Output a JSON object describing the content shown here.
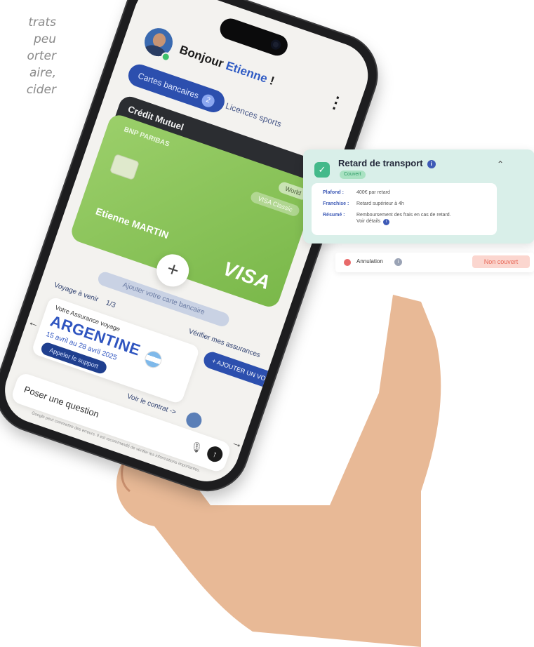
{
  "side_text": [
    "trats",
    "peu",
    "orter",
    "aire,",
    "cider"
  ],
  "greeting": {
    "prefix": "Bonjour",
    "name": "Etienne",
    "suffix": " !"
  },
  "tabs": {
    "active_label": "Cartes bancaires",
    "active_count": "2",
    "other_label": "Licences sports"
  },
  "cards": {
    "back_brand": "Crédit Mutuel",
    "front_bank": "BNP PARIBAS",
    "holder": "Etienne MARTIN",
    "network": "VISA",
    "pill_top": "World",
    "pill_mid": "VISA Classic"
  },
  "add_card_caption": "Ajouter votre carte bancaire",
  "trip": {
    "section_label": "Voyage à venir",
    "pager": "1/3",
    "check_label": "Vérifier mes assurances",
    "insurance_label": "Votre Assurance voyage",
    "country": "ARGENTINE",
    "dates": "15 avril au 28 avril 2025",
    "support_button": "Appeler le support",
    "add_trip_button": "+ AJOUTER UN VOYAGE",
    "contract_link": "Voir le contrat ->"
  },
  "ask": {
    "placeholder": "Poser une question",
    "disclaimer": "Google peut commettre des erreurs. Il est recommandé de vérifier les informations importantes."
  },
  "panel": {
    "title": "Retard de transport",
    "status": "Couvert",
    "rows": [
      {
        "key": "Plafond :",
        "value": "400€ par retard"
      },
      {
        "key": "Franchise :",
        "value": "Retard supérieur à 4h"
      },
      {
        "key": "Résumé :",
        "value": "Remboursement des frais en cas de retard.",
        "value2": "Voir détails"
      }
    ]
  },
  "annulation": {
    "label": "Annulation",
    "status": "Non couvert"
  },
  "colors": {
    "accent_blue": "#2c4fae",
    "covered_green": "#43b98a",
    "not_covered_red": "#e86a5a",
    "card_green": "#8cc45a"
  }
}
